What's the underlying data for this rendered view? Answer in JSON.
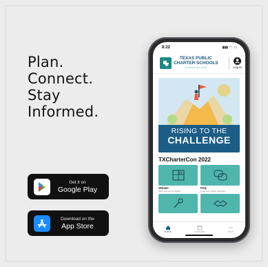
{
  "headline": {
    "lines": [
      "Plan.",
      "Connect.",
      "Stay",
      "Informed."
    ]
  },
  "stores": {
    "google_play": {
      "small": "Get it on",
      "big": "Google Play"
    },
    "app_store": {
      "small": "Download on the",
      "big": "App Store"
    }
  },
  "phone": {
    "status_time": "8:22",
    "logo": {
      "line1": "TEXAS PUBLIC",
      "line2": "CHARTER SCHOOLS",
      "line3": "ASSOCIATION"
    },
    "login_label": "Log In",
    "hero": {
      "line1": "RISING TO THE",
      "line2": "CHALLENGE"
    },
    "section_title": "TXCharterCon 2022",
    "tiles": [
      {
        "label": "Venues",
        "sub": "Maps and venue details"
      },
      {
        "label": "FAQ",
        "sub": "Frequently asked questions"
      },
      {
        "label": "",
        "sub": ""
      },
      {
        "label": "",
        "sub": ""
      }
    ],
    "tabs": [
      {
        "label": "Home"
      },
      {
        "label": "Schedule"
      },
      {
        "label": "More"
      }
    ]
  },
  "colors": {
    "accent_teal": "#4fb6ad",
    "brand_blue": "#1b5d86",
    "button_black": "#111111"
  }
}
